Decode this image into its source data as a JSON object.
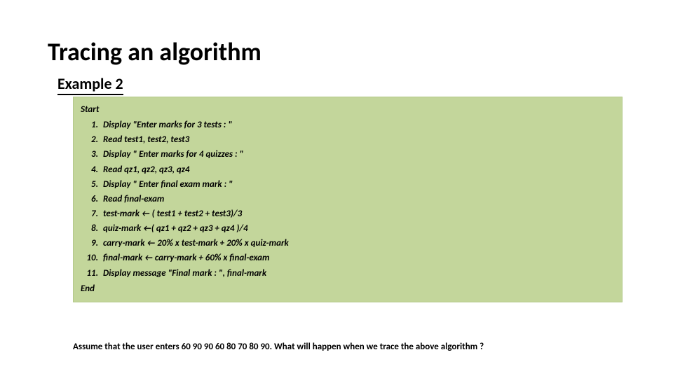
{
  "title": "Tracing an algorithm",
  "subtitle": "Example 2",
  "algo": {
    "start": "Start",
    "end": "End",
    "steps": [
      "Display \"Enter marks for  3 tests : \"",
      "Read test1, test2, test3",
      "Display \" Enter marks for 4 quizzes : \"",
      "Read qz1, qz2, qz3, qz4",
      "Display \" Enter final exam mark : \"",
      "Read final-exam",
      "test-mark ← ( test1 + test2 + test3)/3",
      "quiz-mark ←( qz1 + qz2 + qz3 + qz4 )/4",
      "carry-mark ← 20% x test-mark + 20% x quiz-mark",
      "final-mark ← carry-mark + 60% x final-exam",
      "Display message \"Final  mark : \",  final-mark"
    ]
  },
  "question": "Assume that the user enters  60 90 90 60 80 70 80 90.  What will happen when we trace the above algorithm ?"
}
